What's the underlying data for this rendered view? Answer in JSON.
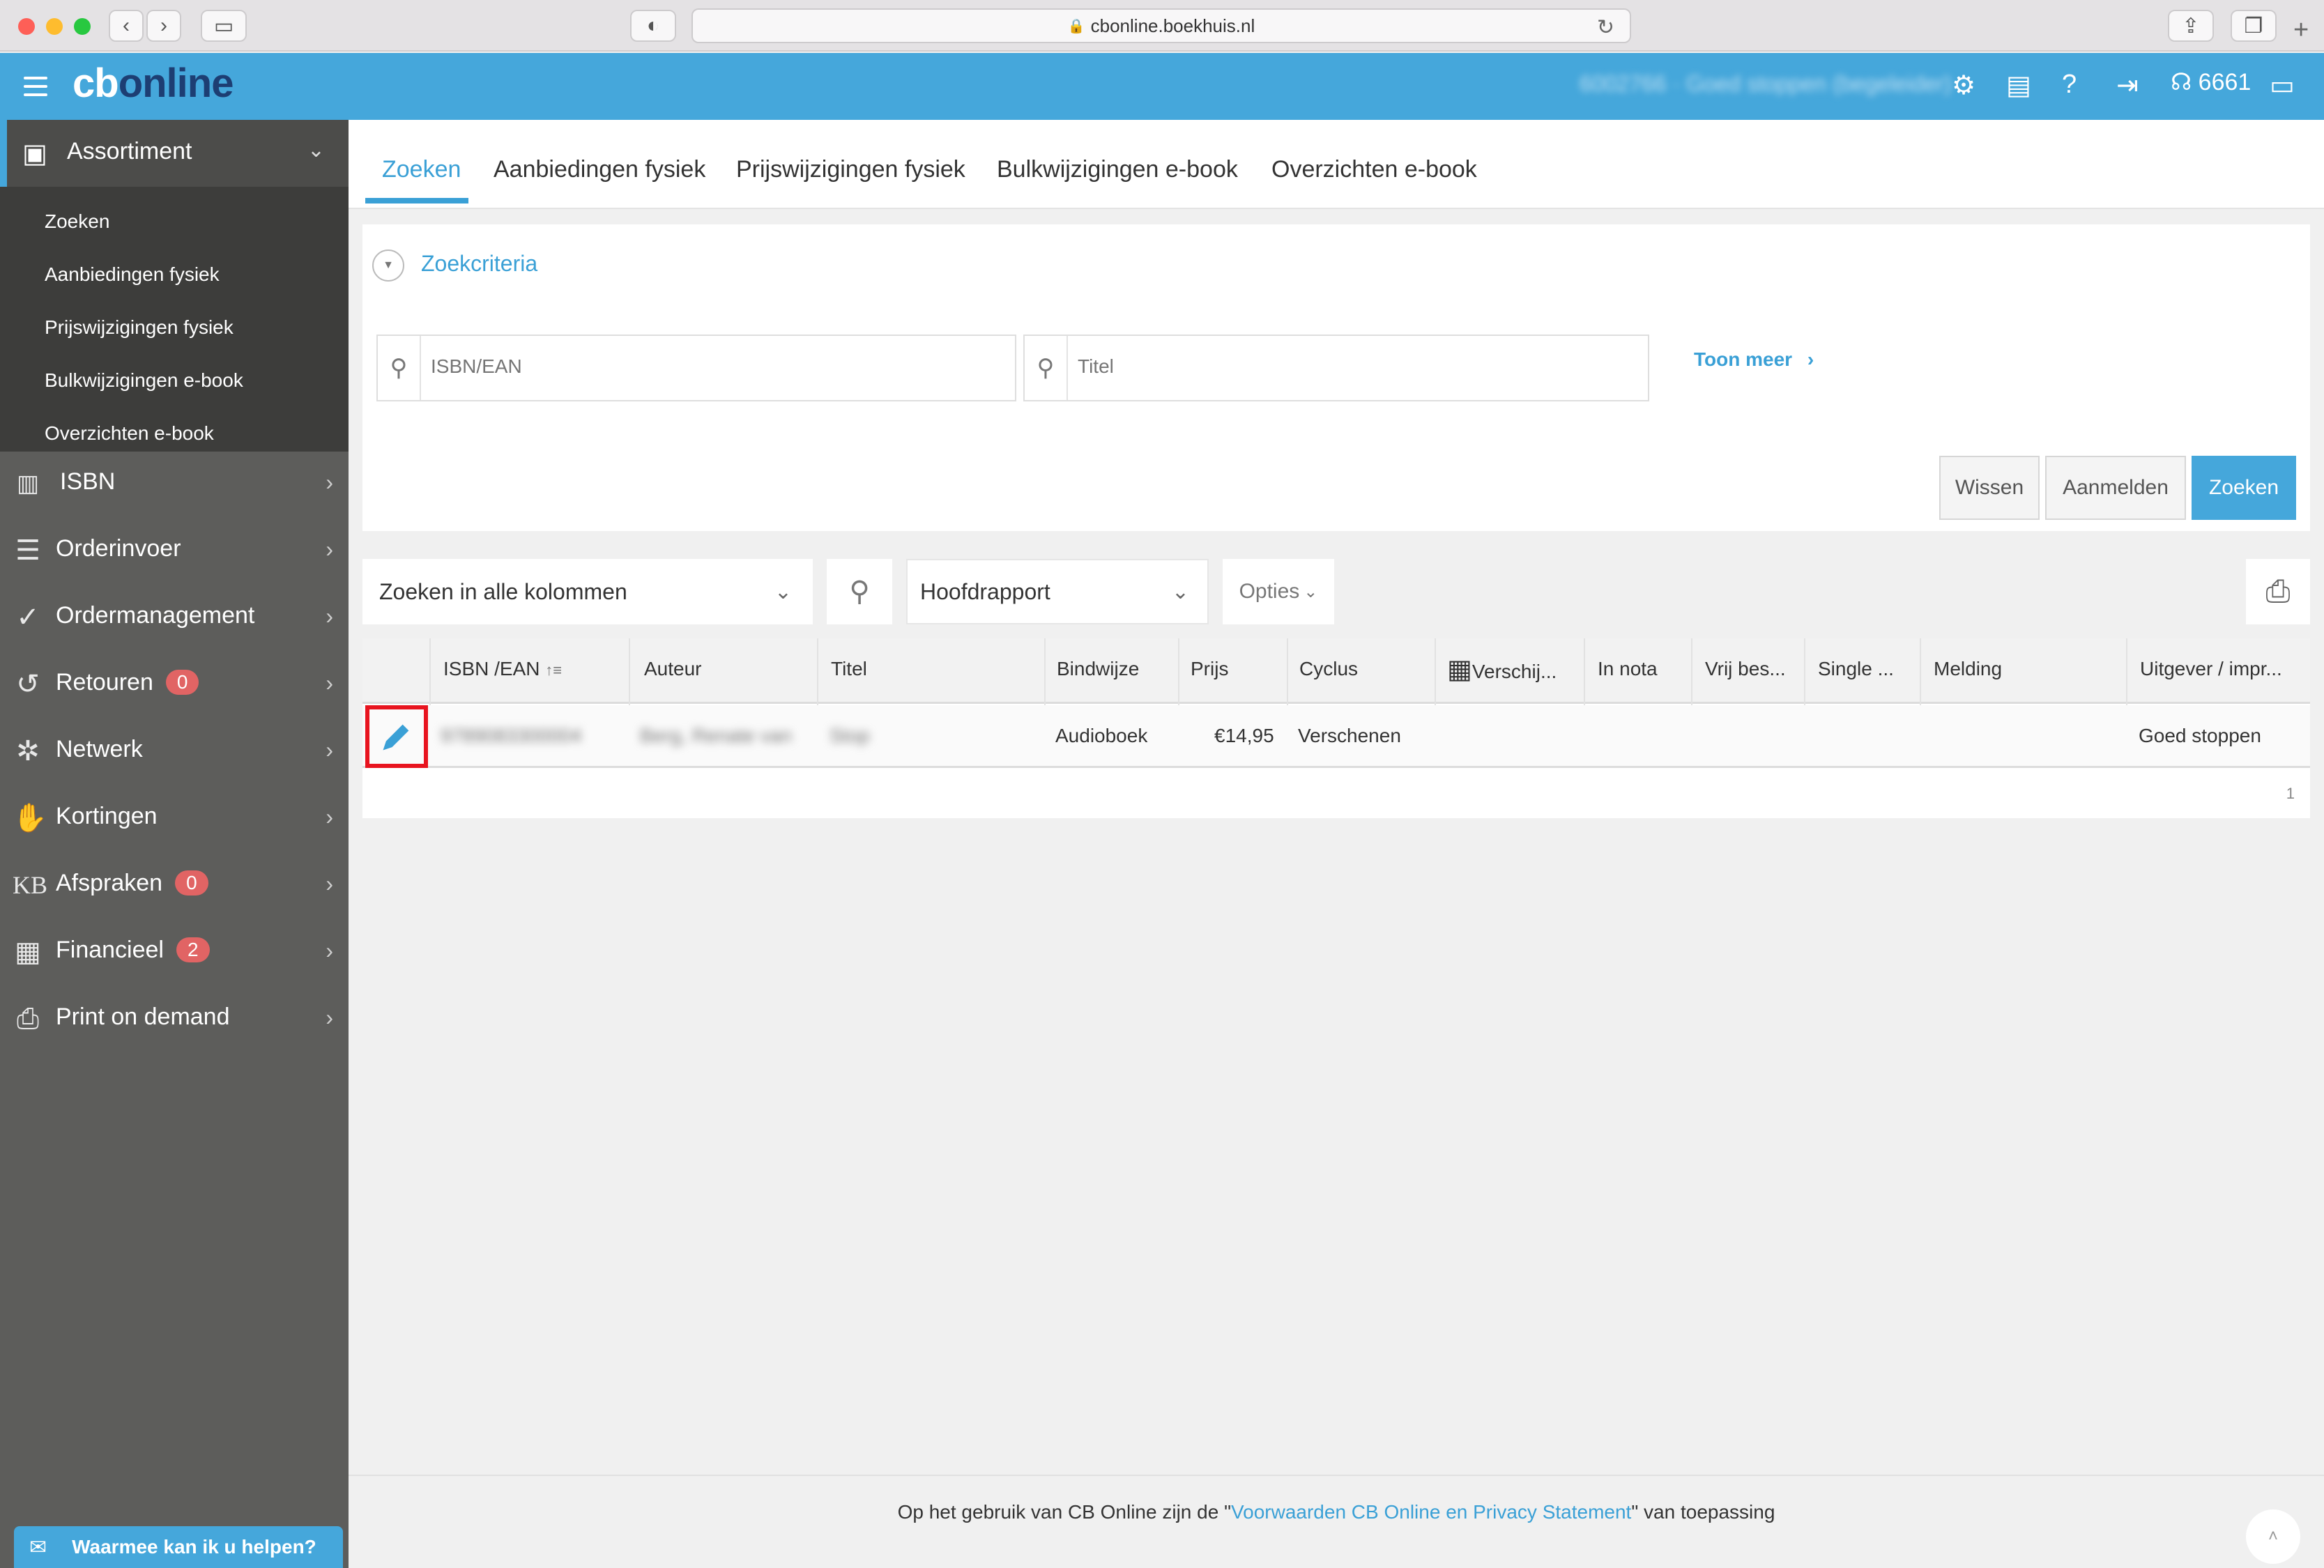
{
  "browser": {
    "url": "cbonline.boekhuis.nl"
  },
  "app": {
    "logo_cb": "cb",
    "logo_online": "online",
    "account": "6002766 · Goed stoppen (begeleider)",
    "count": "6661"
  },
  "sidebar": {
    "header": "Assortiment",
    "subitems": [
      "Zoeken",
      "Aanbiedingen fysiek",
      "Prijswijzigingen fysiek",
      "Bulkwijzigingen e-book",
      "Overzichten e-book"
    ],
    "items": [
      {
        "label": "ISBN",
        "icon": "barcode-icon"
      },
      {
        "label": "Orderinvoer",
        "icon": "clipboard-icon"
      },
      {
        "label": "Ordermanagement",
        "icon": "check-circle-icon"
      },
      {
        "label": "Retouren",
        "icon": "return-icon",
        "badge": "0"
      },
      {
        "label": "Netwerk",
        "icon": "network-icon"
      },
      {
        "label": "Kortingen",
        "icon": "handshake-icon"
      },
      {
        "label": "Afspraken",
        "icon": "kb-icon",
        "badge": "0"
      },
      {
        "label": "Financieel",
        "icon": "finance-icon",
        "badge": "2"
      },
      {
        "label": "Print on demand",
        "icon": "print-on-demand-icon"
      }
    ],
    "help": "Waarmee kan ik u helpen?"
  },
  "tabs": [
    "Zoeken",
    "Aanbiedingen fysiek",
    "Prijswijzigingen fysiek",
    "Bulkwijzigingen e-book",
    "Overzichten e-book"
  ],
  "criteria": {
    "title": "Zoekcriteria",
    "isbn_placeholder": "ISBN/EAN",
    "title_placeholder": "Titel",
    "more": "Toon meer",
    "btn_clear": "Wissen",
    "btn_register": "Aanmelden",
    "btn_search": "Zoeken"
  },
  "toolbar": {
    "search_all": "Zoeken in alle kolommen",
    "report": "Hoofdrapport",
    "options": "Opties"
  },
  "table": {
    "columns": [
      "ISBN /EAN",
      "Auteur",
      "Titel",
      "Bindwijze",
      "Prijs",
      "Cyclus",
      "Verschij...",
      "In nota",
      "Vrij bes...",
      "Single ...",
      "Melding",
      "Uitgever / impr..."
    ],
    "row": {
      "isbn": "9789083300004",
      "auteur": "Berg, Renate van",
      "titel": "Stop",
      "bindwijze": "Audioboek",
      "prijs": "€14,95",
      "cyclus": "Verschenen",
      "uitgever": "Goed stoppen"
    },
    "page": "1"
  },
  "footer": {
    "pre": "Op het gebruik van CB Online zijn de \"",
    "link": "Voorwaarden CB Online en Privacy Statement",
    "post": "\" van toepassing"
  }
}
